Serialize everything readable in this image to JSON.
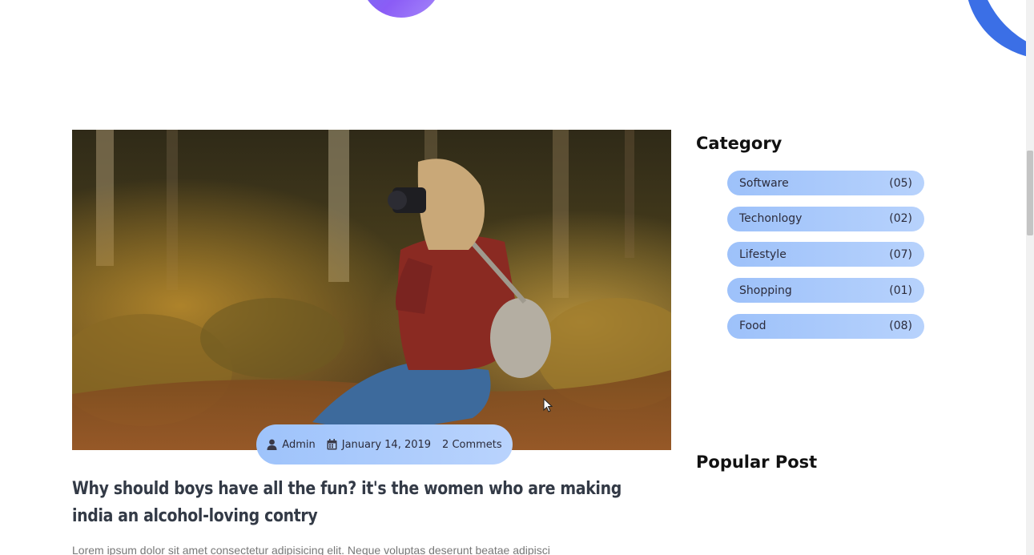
{
  "article": {
    "meta": {
      "author": "Admin",
      "date": "January 14, 2019",
      "comments": "2 Commets"
    },
    "title": "Why should boys have all the fun? it's the women who are making india an alcohol-loving contry",
    "excerpt": "Lorem ipsum dolor sit amet consectetur adipisicing elit. Neque voluptas deserunt beatae adipisci"
  },
  "sidebar": {
    "category_heading": "Category",
    "categories": [
      {
        "label": "Software",
        "count": "(05)"
      },
      {
        "label": "Techonlogy",
        "count": "(02)"
      },
      {
        "label": "Lifestyle",
        "count": "(07)"
      },
      {
        "label": "Shopping",
        "count": "(01)"
      },
      {
        "label": "Food",
        "count": "(08)"
      }
    ],
    "popular_heading": "Popular Post"
  },
  "colors": {
    "accent_gradient_start": "#9dc1fa",
    "accent_gradient_end": "#b7d2fc",
    "title_text": "#333a46"
  },
  "icons": {
    "author": "user-icon",
    "date": "calendar-icon"
  }
}
